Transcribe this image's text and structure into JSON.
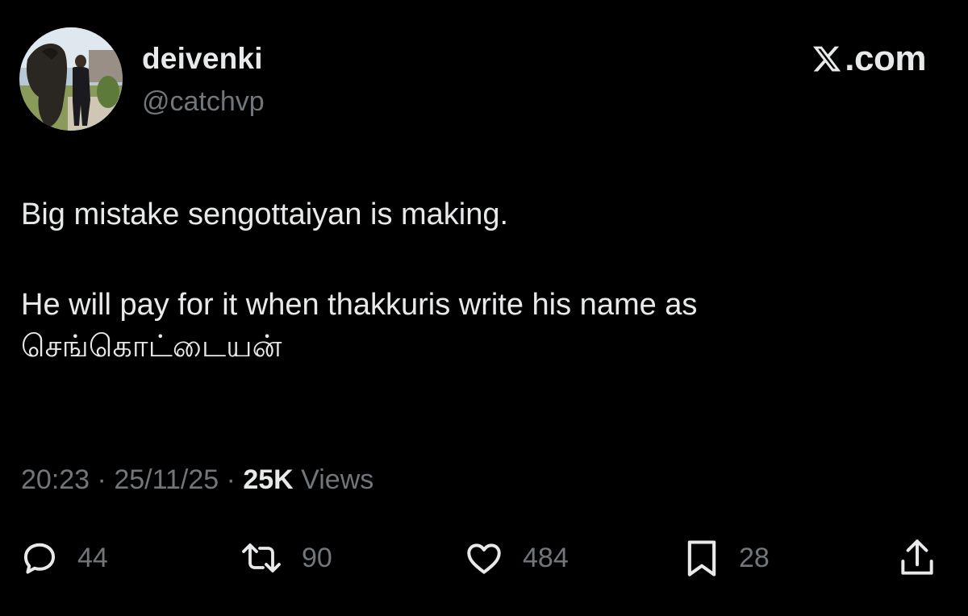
{
  "author": {
    "display_name": "deivenki",
    "handle": "@catchvp"
  },
  "brand": {
    "text": ".com",
    "icon": "x-logo-icon"
  },
  "tweet": {
    "paragraph_1": "Big mistake sengottaiyan is making.",
    "paragraph_2_line_1": "He will pay for it when thakkuris write his name as",
    "paragraph_2_line_2": "செங்கொட்டையன்"
  },
  "meta": {
    "time": "20:23",
    "separator_1": " · ",
    "date": "25/11/25",
    "separator_2": " · ",
    "views_count": "25K",
    "views_label": " Views"
  },
  "actions": {
    "reply": {
      "icon": "reply-icon",
      "count": "44"
    },
    "repost": {
      "icon": "repost-icon",
      "count": "90"
    },
    "like": {
      "icon": "heart-icon",
      "count": "484"
    },
    "bookmark": {
      "icon": "bookmark-icon",
      "count": "28"
    },
    "share": {
      "icon": "share-icon"
    }
  },
  "colors": {
    "background": "#000000",
    "primary_text": "#e7e9ea",
    "secondary_text": "#71767b"
  }
}
